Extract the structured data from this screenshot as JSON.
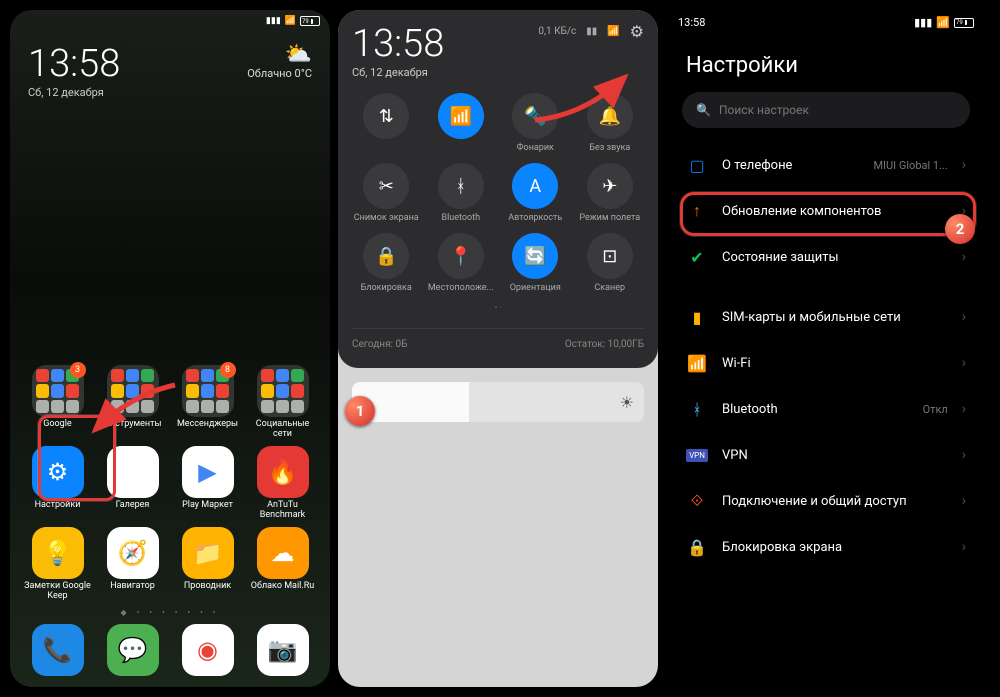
{
  "status": {
    "battery": "79",
    "time_left": "13:58",
    "time_mid_kb": "0,1 КБ/с"
  },
  "screen1": {
    "time": "13:58",
    "date": "Сб, 12 декабря",
    "weather": {
      "cond": "Облачно",
      "temp": "0°C"
    },
    "folders": [
      {
        "label": "Google",
        "badge": "3"
      },
      {
        "label": "Инструменты",
        "badge": null
      },
      {
        "label": "Мессенджеры",
        "badge": "8"
      },
      {
        "label": "Социальные сети",
        "badge": null
      }
    ],
    "apps": [
      {
        "label": "Настройки",
        "color": "#0a84ff",
        "glyph": "⚙"
      },
      {
        "label": "Галерея",
        "color": "#fff",
        "glyph": ""
      },
      {
        "label": "Play Маркет",
        "color": "#fff",
        "glyph": "▶"
      },
      {
        "label": "AnTuTu Benchmark",
        "color": "#e53935",
        "glyph": "🔥"
      },
      {
        "label": "Заметки Google Keep",
        "color": "#fbbc05",
        "glyph": "💡"
      },
      {
        "label": "Навигатор",
        "color": "#fff",
        "glyph": "🧭"
      },
      {
        "label": "Проводник",
        "color": "#ffb300",
        "glyph": "📁"
      },
      {
        "label": "Облако Mail.Ru",
        "color": "#ff9800",
        "glyph": "☁"
      }
    ]
  },
  "screen2": {
    "time": "13:58",
    "date": "Сб, 12 декабря",
    "qs": [
      {
        "glyph": "⇅",
        "label": ""
      },
      {
        "glyph": "📶",
        "label": "",
        "on": true
      },
      {
        "glyph": "🔦",
        "label": "Фонарик"
      },
      {
        "glyph": "🔔",
        "label": "Без звука"
      },
      {
        "glyph": "✂",
        "label": "Снимок экрана"
      },
      {
        "glyph": "ᚼ",
        "label": "Bluetooth"
      },
      {
        "glyph": "A",
        "label": "Автояркость",
        "on": true
      },
      {
        "glyph": "✈",
        "label": "Режим полета"
      },
      {
        "glyph": "🔒",
        "label": "Блокировка"
      },
      {
        "glyph": "📍",
        "label": "Местоположе..."
      },
      {
        "glyph": "🔄",
        "label": "Ориентация",
        "on": true
      },
      {
        "glyph": "⊡",
        "label": "Сканер"
      }
    ],
    "storage": {
      "today": "Сегодня: 0Б",
      "remain": "Остаток: 10,00ГБ"
    }
  },
  "screen3": {
    "title": "Настройки",
    "search": "Поиск настроек",
    "items_a": [
      {
        "icon": "▢",
        "color": "#0a84ff",
        "label": "О телефоне",
        "value": "MIUI Global 1..."
      },
      {
        "icon": "↑",
        "color": "#ff6d00",
        "label": "Обновление компонентов",
        "value": ""
      },
      {
        "icon": "✔",
        "color": "#00c853",
        "label": "Состояние защиты",
        "value": ""
      }
    ],
    "items_b": [
      {
        "icon": "▮",
        "color": "#ffb300",
        "label": "SIM-карты и мобильные сети",
        "value": ""
      },
      {
        "icon": "📶",
        "color": "#4fc3f7",
        "label": "Wi-Fi",
        "value": ""
      },
      {
        "icon": "ᚼ",
        "color": "#4fc3f7",
        "label": "Bluetooth",
        "value": "Откл"
      },
      {
        "icon": "VPN",
        "color": "#3f51b5",
        "label": "VPN",
        "value": ""
      },
      {
        "icon": "⟐",
        "color": "#ff5722",
        "label": "Подключение и общий доступ",
        "value": ""
      },
      {
        "icon": "🔒",
        "color": "#ef5350",
        "label": "Блокировка экрана",
        "value": ""
      }
    ]
  },
  "markers": {
    "n1": "1",
    "n2": "2"
  }
}
